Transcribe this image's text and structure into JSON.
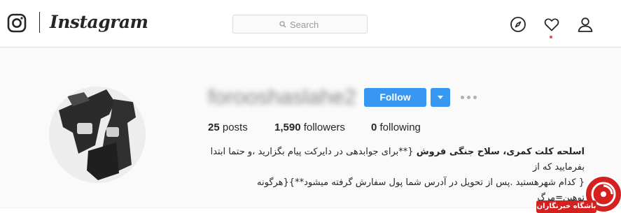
{
  "header": {
    "wordmark": "Instagram",
    "search_placeholder": "Search",
    "icons": [
      "instagram-glyph-icon",
      "compass-icon",
      "heart-icon",
      "user-icon"
    ],
    "notification_dot_color": "#ed4956"
  },
  "profile": {
    "username": "forooshaslahe2",
    "follow_label": "Follow",
    "accent_color": "#3897f0",
    "stats": {
      "posts_count": "25",
      "posts_label": "posts",
      "followers_count": "1,590",
      "followers_label": "followers",
      "following_count": "0",
      "following_label": "following"
    },
    "bio": {
      "name": "اسلحه کلت کمری، سلاح جنگی فروش",
      "line1": "{**برای جوابدهی در دایرکت پیام بگزارید ،و حتما ابتدا بفرمایید که از",
      "line2": "{ کدام شهرهستید .پس از تحویل در آدرس شما پول سفارش گرفته میشود**}{هرگونه توهین=مرگ"
    }
  },
  "watermark": {
    "text": "باشگاه خبرنگاران",
    "color": "#d4201f"
  }
}
